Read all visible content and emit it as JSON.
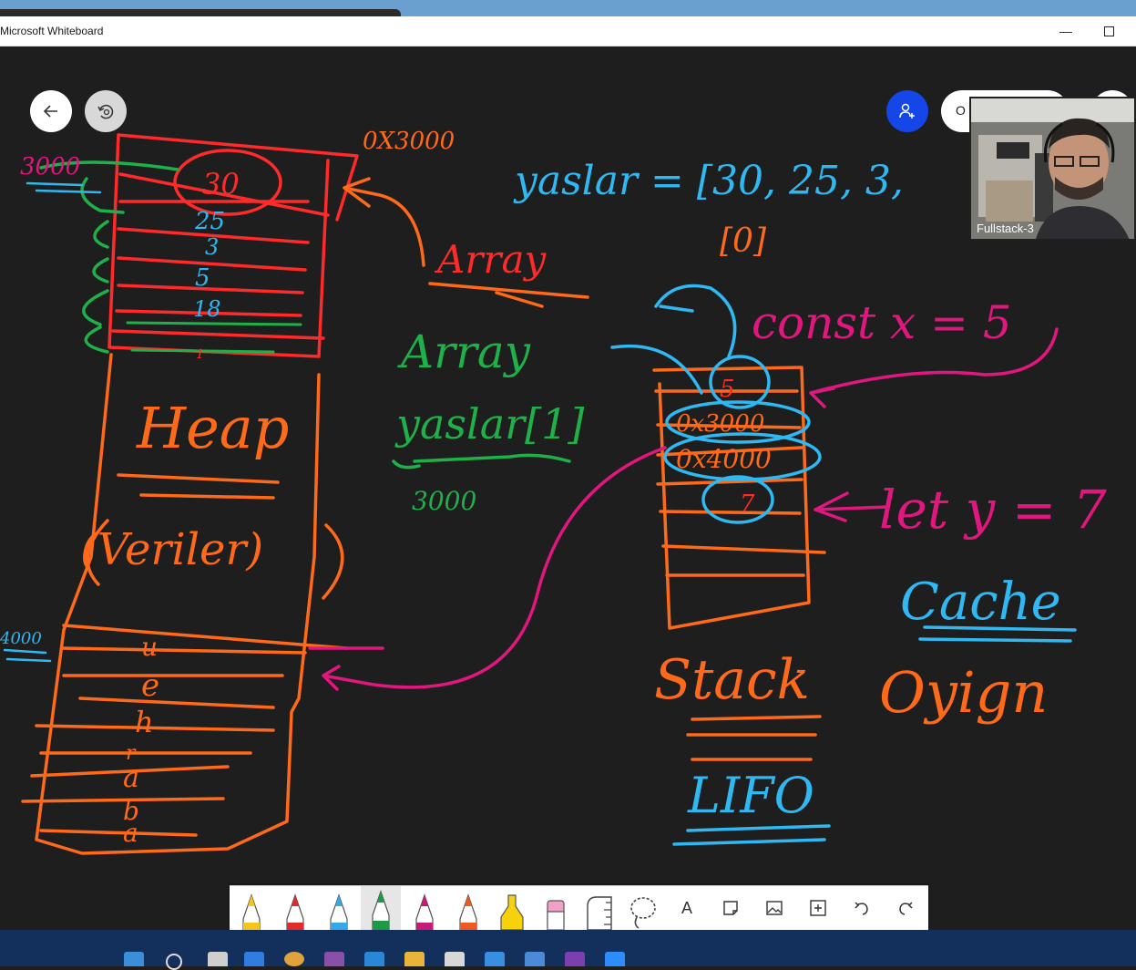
{
  "window": {
    "title": "Microsoft Whiteboard",
    "minimize_symbol": "—",
    "maximize_symbol": "□"
  },
  "header": {
    "back_icon": "arrow-left-icon",
    "replay_icon": "history-replay-icon",
    "invite_icon": "add-person-icon",
    "options_label": "O",
    "more_icon": "more-icon",
    "accent_invite": "#1546e8"
  },
  "video": {
    "participant_name": "Fullstack-3"
  },
  "whiteboard": {
    "heap_title": "Heap",
    "heap_note": "(Veriler)",
    "heap_top_address": "0X3000",
    "heap_left_address": "3000",
    "heap_bottom_address": "4000",
    "heap_top_values": [
      "30",
      "25",
      "3",
      "5",
      "18",
      "1"
    ],
    "heap_bottom_chars": [
      "u",
      "e",
      "h",
      "r",
      "a",
      "b",
      "a"
    ],
    "array_red_label": "Array",
    "assignment": "yaslar = [30, 25, 3,",
    "assignment_cont": "[0]",
    "array_green_label": "Array",
    "index_expr": "yaslar[1]",
    "index_result": "3000",
    "const_decl": "const x = 5",
    "let_decl": "let y = 7",
    "stack_values": [
      "5",
      "0x3000",
      "0x4000",
      "7"
    ],
    "stack_title": "Stack",
    "lifo": "LIFO",
    "cache": "Cache",
    "cache_note": "Oyign",
    "colors": {
      "background": "#1e1e1e",
      "orange": "#ff6a1a",
      "red": "#ff2a2a",
      "blue": "#2fb8f2",
      "green": "#1fb04a",
      "magenta": "#e0177f"
    }
  },
  "toolbar": {
    "tools": [
      {
        "name": "pen-yellow-icon",
        "color": "#f5c51b"
      },
      {
        "name": "pen-red-icon",
        "color": "#e12c2c"
      },
      {
        "name": "pen-blue-icon",
        "color": "#35a8e8"
      },
      {
        "name": "pen-green-icon",
        "color": "#1d9a45",
        "selected": true
      },
      {
        "name": "pen-magenta-icon",
        "color": "#c81978"
      },
      {
        "name": "pen-orange-icon",
        "color": "#f05a22"
      },
      {
        "name": "highlighter-icon",
        "color": "#f6d10c"
      },
      {
        "name": "eraser-icon",
        "color": "#f2a0c8"
      },
      {
        "name": "ruler-icon",
        "color": "#444444"
      },
      {
        "name": "lasso-icon",
        "color": "#444444"
      },
      {
        "name": "text-icon",
        "label": "A"
      },
      {
        "name": "note-icon"
      },
      {
        "name": "image-icon"
      },
      {
        "name": "insert-icon"
      },
      {
        "name": "undo-icon"
      },
      {
        "name": "redo-icon"
      }
    ]
  }
}
